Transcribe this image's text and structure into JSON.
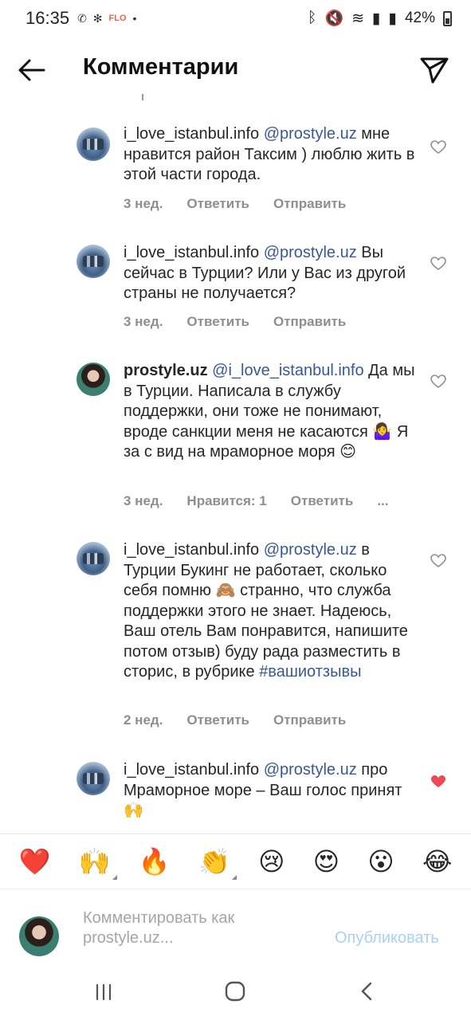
{
  "status_bar": {
    "time": "16:35",
    "flo_label": "FLO",
    "battery": "42%"
  },
  "header": {
    "title": "Комментарии"
  },
  "comments": [
    {
      "username": "i_love_istanbul.info",
      "mention": "@prostyle.uz",
      "text": " мне нравится район Таксим ) люблю жить в этой части города.",
      "time": "3 нед.",
      "reply": "Ответить",
      "send": "Отправить",
      "liked": false
    },
    {
      "username": "i_love_istanbul.info",
      "mention": "@prostyle.uz",
      "text": " Вы сейчас в Турции? Или у Вас из другой страны не получается?",
      "time": "3 нед.",
      "reply": "Ответить",
      "send": "Отправить",
      "liked": false
    },
    {
      "username": "prostyle.uz",
      "mention": "@i_love_istanbul.info",
      "text": " Да мы в Турции. Написала в службу поддержки, они тоже не понимают, вроде санкции меня не касаются 🤷‍♀️ Я за с вид на мраморное моря 😊",
      "time": "3 нед.",
      "likes": "Нравится: 1",
      "reply": "Ответить",
      "more": "...",
      "liked": false
    },
    {
      "username": "i_love_istanbul.info",
      "mention": "@prostyle.uz",
      "text": " в Турции Букинг не работает, сколько себя помню 🙈 странно, что служба поддержки этого не знает. Надеюсь, Ваш отель Вам понравится, напишите потом отзыв) буду рада разместить в сторис, в рубрике ",
      "hashtag": "#вашиотзывы",
      "time": "2 нед.",
      "reply": "Ответить",
      "send": "Отправить",
      "liked": false
    },
    {
      "username": "i_love_istanbul.info",
      "mention": "@prostyle.uz",
      "text": " про Мраморное море – Ваш голос принят 🙌",
      "liked": true
    }
  ],
  "emoji_bar": [
    "❤️",
    "🙌",
    "🔥",
    "👏",
    "😢",
    "😍",
    "😮",
    "😂"
  ],
  "compose": {
    "placeholder": "Комментировать как prostyle.uz...",
    "publish": "Опубликовать"
  },
  "colors": {
    "mention": "#385898",
    "meta": "#8e8e8e",
    "publish_disabled": "#a8d1f5",
    "liked_heart": "#ed4956"
  }
}
